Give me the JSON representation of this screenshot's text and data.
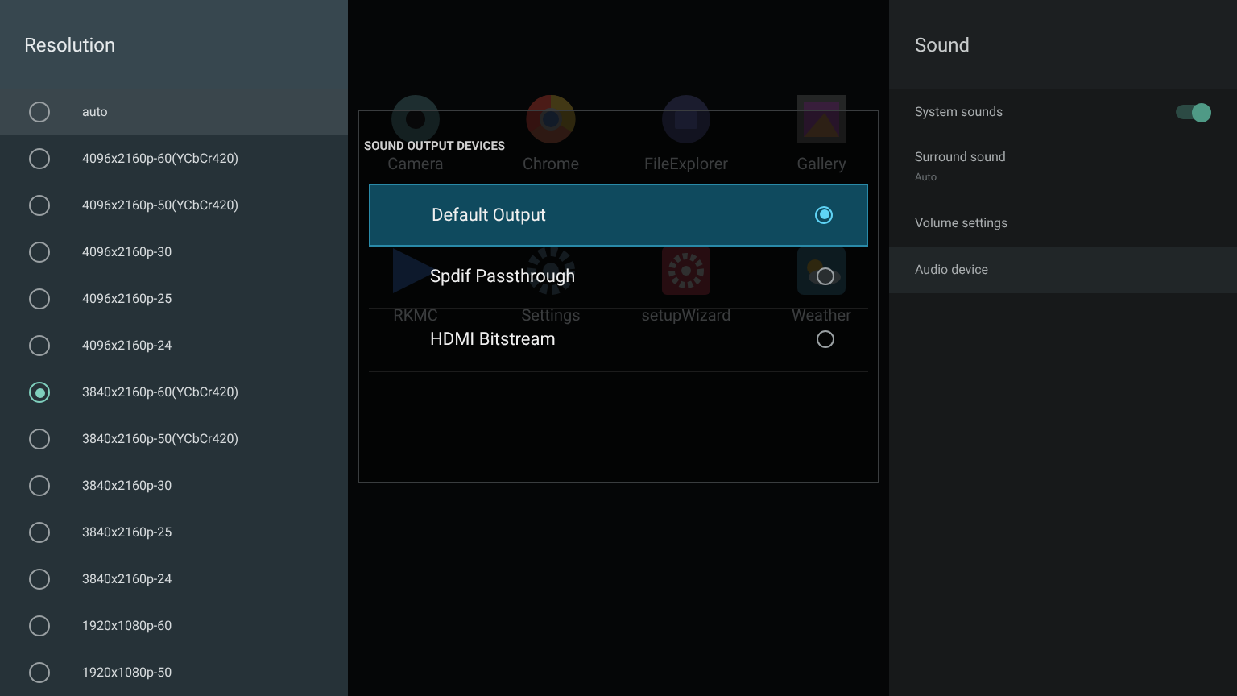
{
  "resolution_panel": {
    "title": "Resolution",
    "options": [
      {
        "label": "auto",
        "selected": false,
        "focused": true
      },
      {
        "label": "4096x2160p-60(YCbCr420)",
        "selected": false,
        "focused": false
      },
      {
        "label": "4096x2160p-50(YCbCr420)",
        "selected": false,
        "focused": false
      },
      {
        "label": "4096x2160p-30",
        "selected": false,
        "focused": false
      },
      {
        "label": "4096x2160p-25",
        "selected": false,
        "focused": false
      },
      {
        "label": "4096x2160p-24",
        "selected": false,
        "focused": false
      },
      {
        "label": "3840x2160p-60(YCbCr420)",
        "selected": true,
        "focused": false
      },
      {
        "label": "3840x2160p-50(YCbCr420)",
        "selected": false,
        "focused": false
      },
      {
        "label": "3840x2160p-30",
        "selected": false,
        "focused": false
      },
      {
        "label": "3840x2160p-25",
        "selected": false,
        "focused": false
      },
      {
        "label": "3840x2160p-24",
        "selected": false,
        "focused": false
      },
      {
        "label": "1920x1080p-60",
        "selected": false,
        "focused": false
      },
      {
        "label": "1920x1080p-50",
        "selected": false,
        "focused": false
      }
    ]
  },
  "launcher_apps": [
    {
      "label": "Camera"
    },
    {
      "label": "Chrome"
    },
    {
      "label": "FileExplorer"
    },
    {
      "label": "Gallery"
    },
    {
      "label": "RKMC"
    },
    {
      "label": "Settings"
    },
    {
      "label": "setupWizard"
    },
    {
      "label": "Weather"
    }
  ],
  "dialog": {
    "title": "SOUND OUTPUT DEVICES",
    "options": [
      {
        "label": "Default Output",
        "selected": true
      },
      {
        "label": "Spdif Passthrough",
        "selected": false
      },
      {
        "label": "HDMI Bitstream",
        "selected": false
      }
    ]
  },
  "sound_panel": {
    "title": "Sound",
    "items": [
      {
        "kind": "toggle",
        "label": "System sounds",
        "on": true,
        "focused": false
      },
      {
        "kind": "text",
        "label": "Surround sound",
        "value": "Auto",
        "focused": false
      },
      {
        "kind": "text",
        "label": "Volume settings",
        "focused": false
      },
      {
        "kind": "text",
        "label": "Audio device",
        "focused": true
      }
    ]
  }
}
